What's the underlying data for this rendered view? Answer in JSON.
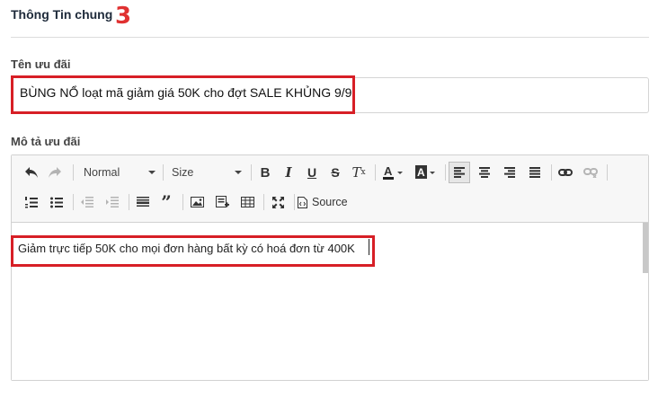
{
  "section": {
    "title": "Thông Tin chung",
    "step_number": "3"
  },
  "name_field": {
    "label": "Tên ưu đãi",
    "value": "BÙNG NỔ loạt mã giảm giá 50K cho đợt SALE KHỦNG 9/9"
  },
  "description_field": {
    "label": "Mô tả ưu đãi",
    "content": "Giảm trực tiếp 50K cho mọi đơn hàng bất kỳ có hoá đơn từ 400K"
  },
  "toolbar": {
    "format_selected": "Normal",
    "size_selected": "Size",
    "source_label": "Source",
    "icons": {
      "undo": "undo-icon",
      "redo": "redo-icon",
      "bold": "bold-icon",
      "italic": "italic-icon",
      "underline": "underline-icon",
      "strike": "strikethrough-icon",
      "clear": "remove-format-icon",
      "text_color": "text-color-icon",
      "bg_color": "background-color-icon",
      "align_left": "align-left-icon",
      "align_center": "align-center-icon",
      "align_right": "align-right-icon",
      "justify": "justify-icon",
      "link": "link-icon",
      "unlink": "unlink-icon",
      "numbered_list": "numbered-list-icon",
      "bulleted_list": "bulleted-list-icon",
      "outdent": "outdent-icon",
      "indent": "indent-icon",
      "horizontal_line": "horizontal-line-icon",
      "blockquote": "blockquote-icon",
      "image": "image-icon",
      "embed": "embed-icon",
      "table": "table-icon",
      "maximize": "maximize-icon",
      "source": "source-icon"
    }
  },
  "colors": {
    "highlight_box": "#d71f26",
    "step_number": "#e03131"
  }
}
